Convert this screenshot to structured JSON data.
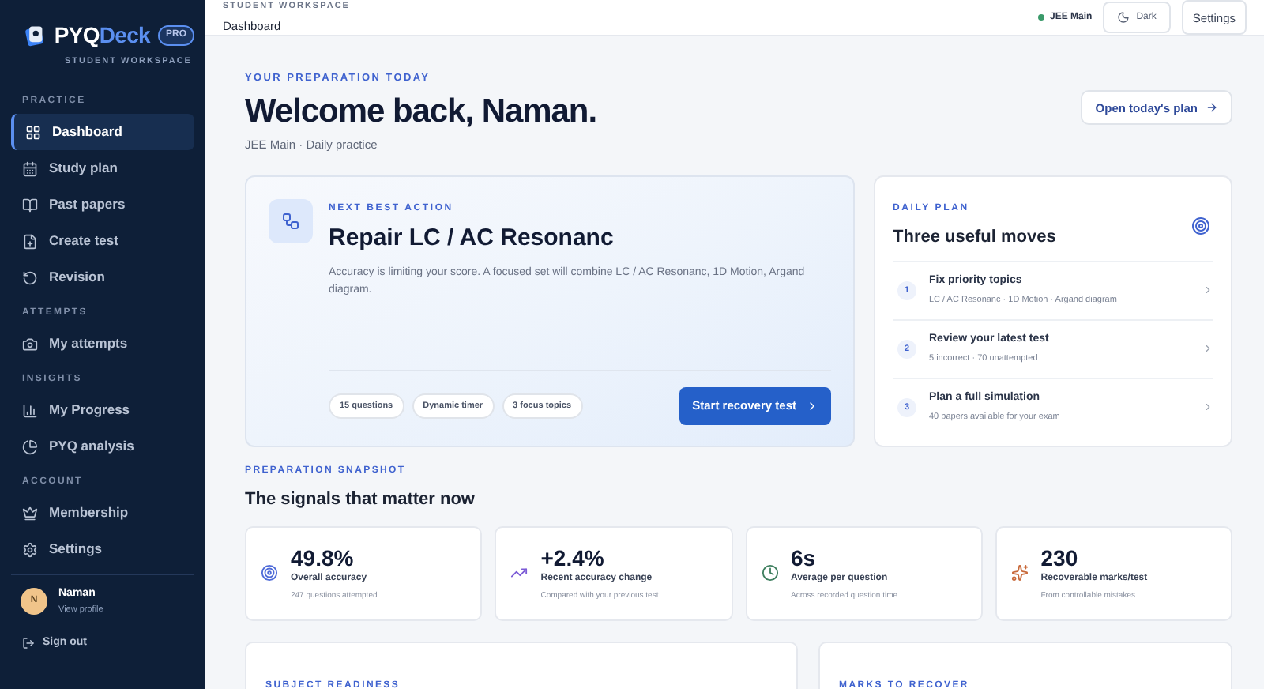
{
  "brand": {
    "name_part_1": "PYQ",
    "name_part_2": "Deck",
    "badge": "PRO",
    "subtitle": "STUDENT WORKSPACE"
  },
  "sidebar": {
    "sections": [
      {
        "title": "PRACTICE",
        "items": [
          {
            "label": "Dashboard",
            "selected": true
          },
          {
            "label": "Study plan",
            "selected": false
          },
          {
            "label": "Past papers",
            "selected": false
          },
          {
            "label": "Create test",
            "selected": false
          },
          {
            "label": "Revision",
            "selected": false
          }
        ]
      },
      {
        "title": "ATTEMPTS",
        "items": [
          {
            "label": "My attempts",
            "selected": false
          }
        ]
      },
      {
        "title": "INSIGHTS",
        "items": [
          {
            "label": "My Progress",
            "selected": false
          },
          {
            "label": "PYQ analysis",
            "selected": false
          }
        ]
      },
      {
        "title": "ACCOUNT",
        "items": [
          {
            "label": "Membership",
            "selected": false
          },
          {
            "label": "Settings",
            "selected": false
          }
        ]
      }
    ],
    "user": {
      "initial": "N",
      "name": "Naman",
      "link": "View profile"
    },
    "sign_out": "Sign out"
  },
  "topbar": {
    "eyebrow": "STUDENT WORKSPACE",
    "title": "Dashboard",
    "exam": "JEE Main",
    "theme_button": "Dark",
    "settings_button": "Settings"
  },
  "hero": {
    "eyebrow": "YOUR PREPARATION TODAY",
    "title": "Welcome back, Naman.",
    "subtitle": "JEE Main · Daily practice",
    "button": "Open today's plan"
  },
  "next_action": {
    "eyebrow": "NEXT BEST ACTION",
    "title": "Repair LC / AC Resonanc",
    "description": "Accuracy is limiting your score. A focused set will combine LC / AC Resonanc, 1D Motion, Argand diagram.",
    "tags": [
      "15 questions",
      "Dynamic timer",
      "3 focus topics"
    ],
    "button": "Start recovery test"
  },
  "daily_plan": {
    "eyebrow": "DAILY PLAN",
    "title": "Three useful moves",
    "items": [
      {
        "number": "1",
        "title": "Fix priority topics",
        "detail": "LC / AC Resonanc · 1D Motion · Argand diagram"
      },
      {
        "number": "2",
        "title": "Review your latest test",
        "detail": "5 incorrect · 70 unattempted"
      },
      {
        "number": "3",
        "title": "Plan a full simulation",
        "detail": "40 papers available for your exam"
      }
    ]
  },
  "snapshot": {
    "eyebrow": "PREPARATION SNAPSHOT",
    "title": "The signals that matter now",
    "stats": [
      {
        "value": "49.8%",
        "label": "Overall accuracy",
        "detail": "247 questions attempted",
        "color": "#4f6bd8"
      },
      {
        "value": "+2.4%",
        "label": "Recent accuracy change",
        "detail": "Compared with your previous test",
        "color": "#7c5cd6"
      },
      {
        "value": "6s",
        "label": "Average per question",
        "detail": "Across recorded question time",
        "color": "#3f7f5f"
      },
      {
        "value": "230",
        "label": "Recoverable marks/test",
        "detail": "From controllable mistakes",
        "color": "#c8693a"
      }
    ]
  },
  "lower_cards": [
    {
      "eyebrow": "SUBJECT READINESS"
    },
    {
      "eyebrow": "MARKS TO RECOVER"
    }
  ]
}
